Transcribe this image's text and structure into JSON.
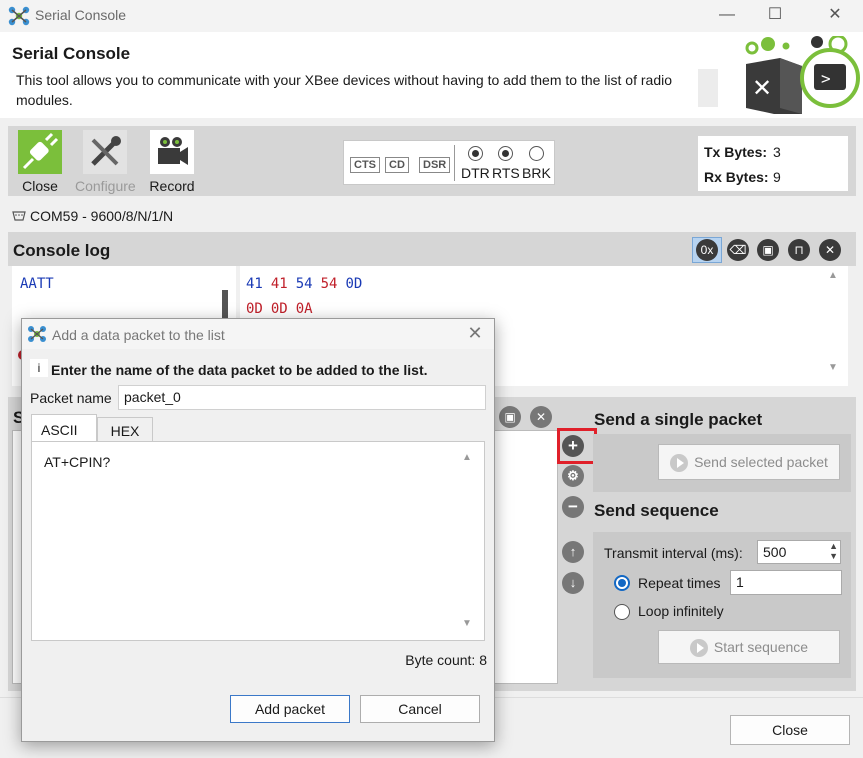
{
  "window": {
    "title": "Serial Console"
  },
  "header": {
    "title": "Serial Console",
    "description": "This tool allows you to communicate with your XBee devices without having to add them to the list of radio modules."
  },
  "toolbar": {
    "close_label": "Close",
    "configure_label": "Configure",
    "record_label": "Record",
    "lamps": [
      "CTS",
      "CD",
      "DSR"
    ],
    "toggles": [
      {
        "label": "DTR",
        "checked": true
      },
      {
        "label": "RTS",
        "checked": true
      },
      {
        "label": "BRK",
        "checked": false
      }
    ],
    "tx_label": "Tx Bytes:",
    "tx_value": "3",
    "rx_label": "Rx Bytes:",
    "rx_value": "9"
  },
  "port": {
    "text": "COM59 - 9600/8/N/1/N"
  },
  "console_log": {
    "title": "Console log",
    "hex_toggle": "0x",
    "ascii_line": "AATT",
    "hex_line1": [
      {
        "text": "41",
        "color": "#1a3ab5"
      },
      {
        "text": "41",
        "color": "#c0202a"
      },
      {
        "text": "54",
        "color": "#1a3ab5"
      },
      {
        "text": "54",
        "color": "#c0202a"
      },
      {
        "text": "0D",
        "color": "#1a3ab5"
      }
    ],
    "hex_line2": [
      {
        "text": "0D",
        "color": "#c0202a"
      },
      {
        "text": "0D",
        "color": "#c0202a"
      },
      {
        "text": "0A",
        "color": "#c0202a"
      }
    ]
  },
  "send_single": {
    "title": "Send a single packet",
    "button": "Send selected packet"
  },
  "send_sequence": {
    "title": "Send sequence",
    "interval_label": "Transmit interval (ms):",
    "interval_value": "500",
    "repeat_label": "Repeat times",
    "repeat_value": "1",
    "loop_label": "Loop infinitely",
    "start_button": "Start sequence"
  },
  "footer": {
    "close_button": "Close"
  },
  "dialog": {
    "title": "Add a data packet to the list",
    "info_icon_text": "i",
    "instruction": "Enter the name of the data packet to be added to the list.",
    "packet_name_label": "Packet name",
    "packet_name_value": "packet_0",
    "tab_ascii": "ASCII",
    "tab_hex": "HEX",
    "content": "AT+CPIN?",
    "byte_count": "Byte count: 8",
    "add_button": "Add packet",
    "cancel_button": "Cancel"
  },
  "colors": {
    "highlight": "#e0202a",
    "radio_accent": "#1368c4",
    "close_icon_bg": "#7bbf3b"
  }
}
